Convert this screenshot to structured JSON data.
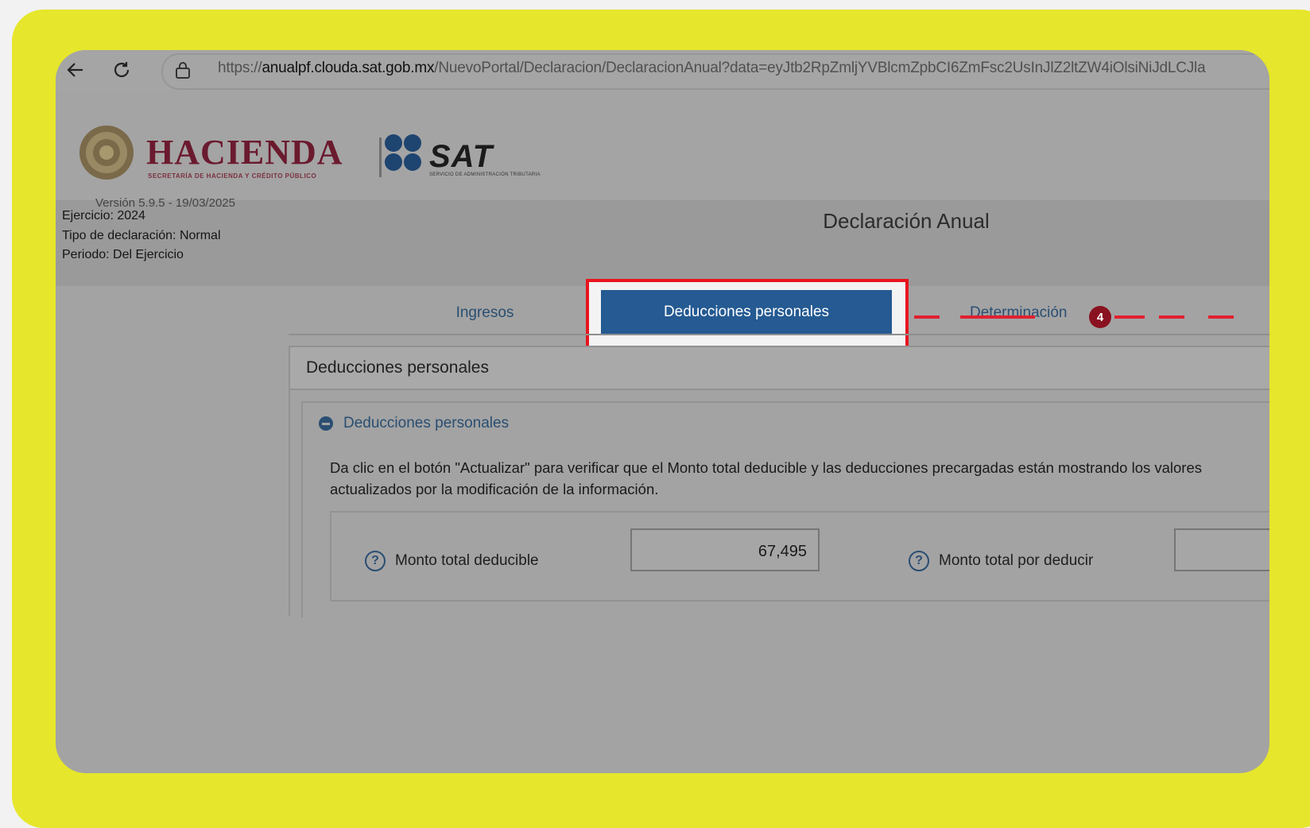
{
  "browser": {
    "url_prefix": "https://",
    "url_host": "anualpf.clouda.sat.gob.mx",
    "url_path": "/NuevoPortal/Declaracion/DeclaracionAnual?data=eyJtb2RpZmljYVBlcmZpbCI6ZmFsc2UsInJlZ2ltZW4iOlsiNiJdLCJla"
  },
  "header": {
    "hacienda_title": "HACIENDA",
    "hacienda_subtitle": "SECRETARÍA DE HACIENDA Y CRÉDITO PÚBLICO",
    "sat_title": "SAT",
    "sat_subtitle": "SERVICIO DE ADMINISTRACIÓN TRIBUTARIA",
    "version": "Versión 5.9.5 - 19/03/2025"
  },
  "info": {
    "ejercicio": "Ejercicio: 2024",
    "tipo": "Tipo de declaración: Normal",
    "periodo": "Periodo: Del Ejercicio",
    "page_title": "Declaración Anual"
  },
  "tabs": {
    "ingresos": "Ingresos",
    "deducciones": "Deducciones personales",
    "determinacion": "Determinación",
    "badge": "4"
  },
  "panel": {
    "title": "Deducciones personales",
    "section_title": "Deducciones personales",
    "description": "Da clic en el botón \"Actualizar\" para verificar que el Monto total deducible y las deducciones precargadas están mostrando los valores actualizados por la modificación de la información.",
    "field1_label": "Monto total deducible",
    "field1_value": "67,495",
    "field2_label": "Monto total por deducir",
    "help_glyph": "?"
  },
  "colors": {
    "accent_yellow": "#e6e62c",
    "active_tab": "#255a92",
    "highlight_red": "#e8141e",
    "badge": "#8a1220"
  }
}
